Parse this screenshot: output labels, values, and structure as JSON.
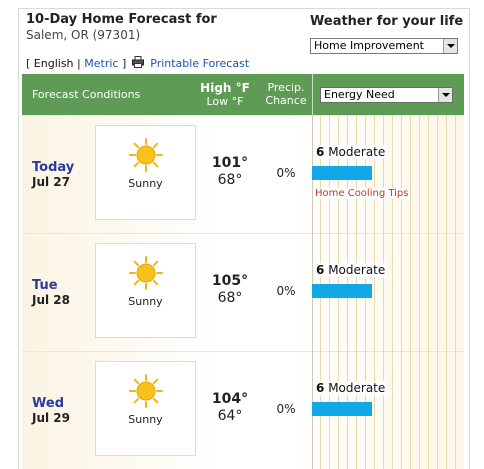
{
  "header": {
    "title": "10-Day Home Forecast for",
    "location": "Salem, OR (97301)"
  },
  "sidebar_select": {
    "heading": "Weather for your life",
    "value": "Home Improvement"
  },
  "links": {
    "open_bracket": "[",
    "english": "English",
    "divider": "|",
    "metric": "Metric",
    "close_bracket": "]",
    "printable": "Printable Forecast"
  },
  "table_header": {
    "conditions": "Forecast Conditions",
    "high": "High °F",
    "low": "Low °F",
    "precip_line1": "Precip.",
    "precip_line2": "Chance",
    "energy_select": "Energy Need"
  },
  "colors": {
    "header_green": "#5e9b55",
    "energy_bar": "#12a8e6",
    "day_blue": "#2b3a9c",
    "tips_red": "#c0392b"
  },
  "icons": {
    "condition": "sun-icon",
    "printer": "printer-icon"
  },
  "forecast": [
    {
      "day": "Today",
      "date": "Jul 27",
      "condition": "Sunny",
      "high": "101°",
      "low": "68°",
      "precip": "0%",
      "energy_value": "6",
      "energy_label": "Moderate",
      "tips": "Home Cooling Tips"
    },
    {
      "day": "Tue",
      "date": "Jul 28",
      "condition": "Sunny",
      "high": "105°",
      "low": "68°",
      "precip": "0%",
      "energy_value": "6",
      "energy_label": "Moderate"
    },
    {
      "day": "Wed",
      "date": "Jul 29",
      "condition": "Sunny",
      "high": "104°",
      "low": "64°",
      "precip": "0%",
      "energy_value": "6",
      "energy_label": "Moderate"
    }
  ]
}
